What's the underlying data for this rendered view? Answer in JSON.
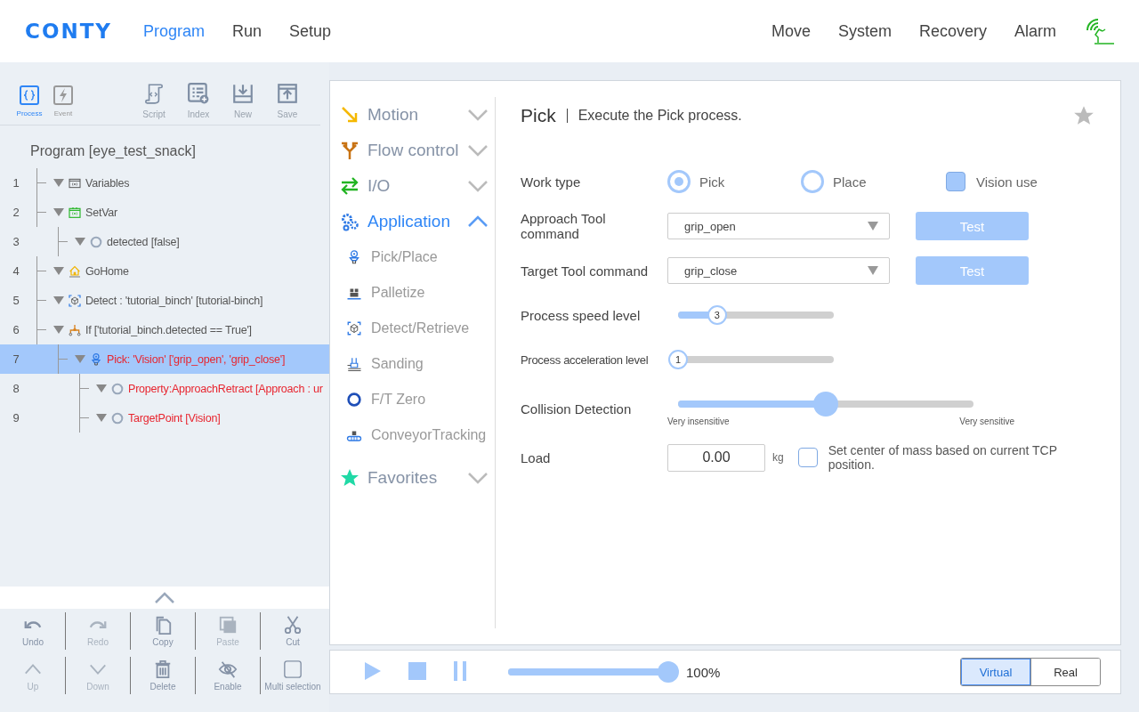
{
  "header": {
    "logo": "CONTY",
    "nav": [
      {
        "label": "Program",
        "selected": true
      },
      {
        "label": "Run",
        "selected": false
      },
      {
        "label": "Setup",
        "selected": false
      }
    ],
    "right_nav": [
      "Move",
      "System",
      "Recovery",
      "Alarm"
    ]
  },
  "left_panel": {
    "modes": [
      {
        "label": "Process",
        "kind": "process",
        "selected": true
      },
      {
        "label": "Event",
        "kind": "event",
        "selected": false
      }
    ],
    "tools": [
      {
        "label": "Script",
        "kind": "script"
      },
      {
        "label": "Index",
        "kind": "index"
      },
      {
        "label": "New",
        "kind": "new"
      },
      {
        "label": "Save",
        "kind": "save"
      }
    ],
    "program_title": "Program [eye_test_snack]",
    "tree": [
      {
        "line": "1",
        "label": "Variables",
        "kind": "variables",
        "selected": false,
        "color": "#555555"
      },
      {
        "line": "2",
        "label": "SetVar",
        "kind": "setvar",
        "selected": false,
        "color": "#555555",
        "children": [
          {
            "line": "3",
            "label": "detected [false]",
            "kind": "property",
            "selected": false,
            "color": "#555555"
          }
        ]
      },
      {
        "line": "4",
        "label": "GoHome",
        "kind": "home",
        "selected": false,
        "color": "#555555"
      },
      {
        "line": "5",
        "label": "Detect : 'tutorial_binch' [tutorial-binch]",
        "kind": "detect",
        "selected": false,
        "color": "#555555"
      },
      {
        "line": "6",
        "label": "If ['tutorial_binch.detected == True']",
        "kind": "if",
        "selected": false,
        "color": "#555555",
        "children": [
          {
            "line": "7",
            "label": "Pick: 'Vision' ['grip_open', 'grip_close']",
            "kind": "pick",
            "selected": true,
            "color": "#e8252f",
            "children": [
              {
                "line": "8",
                "label": "Property:ApproachRetract [Approach : ur",
                "kind": "property",
                "selected": false,
                "color": "#e8252f"
              },
              {
                "line": "9",
                "label": "TargetPoint [Vision]",
                "kind": "property",
                "selected": false,
                "color": "#e8252f"
              }
            ]
          }
        ]
      }
    ],
    "edit_tools": [
      {
        "label": "Undo",
        "kind": "undo",
        "disabled": false
      },
      {
        "label": "Redo",
        "kind": "redo",
        "disabled": true
      },
      {
        "label": "Copy",
        "kind": "copy",
        "disabled": false
      },
      {
        "label": "Paste",
        "kind": "paste",
        "disabled": true
      },
      {
        "label": "Cut",
        "kind": "cut",
        "disabled": false
      },
      {
        "label": "Up",
        "kind": "up",
        "disabled": true
      },
      {
        "label": "Down",
        "kind": "down",
        "disabled": true
      },
      {
        "label": "Delete",
        "kind": "delete",
        "disabled": false
      },
      {
        "label": "Enable",
        "kind": "enable",
        "disabled": false
      },
      {
        "label": "Multi selection",
        "kind": "multi",
        "disabled": false
      }
    ]
  },
  "command_menu": [
    {
      "label": "Motion",
      "kind": "motion",
      "expanded": false
    },
    {
      "label": "Flow control",
      "kind": "flow",
      "expanded": false
    },
    {
      "label": "I/O",
      "kind": "io",
      "expanded": false
    },
    {
      "label": "Application",
      "kind": "application",
      "expanded": true,
      "children": [
        {
          "label": "Pick/Place",
          "kind": "pick"
        },
        {
          "label": "Palletize",
          "kind": "palletize"
        },
        {
          "label": "Detect/Retrieve",
          "kind": "detect"
        },
        {
          "label": "Sanding",
          "kind": "sanding"
        },
        {
          "label": "F/T Zero",
          "kind": "ftzero"
        },
        {
          "label": "ConveyorTracking",
          "kind": "conveyor"
        }
      ]
    },
    {
      "label": "Favorites",
      "kind": "favorites",
      "expanded": false
    }
  ],
  "command": {
    "title": "Pick",
    "description": "Execute the Pick process.",
    "favorite": false,
    "work_type": {
      "label": "Work type",
      "options": [
        {
          "label": "Pick",
          "selected": true
        },
        {
          "label": "Place",
          "selected": false
        }
      ],
      "vision_use": {
        "label": "Vision use",
        "checked": true
      }
    },
    "tool_commands": [
      {
        "label": "Approach Tool command",
        "value": "grip_open",
        "button": "Test"
      },
      {
        "label": "Target Tool command",
        "value": "grip_close",
        "button": "Test"
      }
    ],
    "levels": [
      {
        "label": "Process speed level",
        "level": 0.25,
        "value": "3",
        "kind": "small"
      },
      {
        "label": "Process acceleration level",
        "level": 0,
        "value": "1",
        "kind": "tiny"
      }
    ],
    "collision": {
      "label": "Collision Detection",
      "level": 0.5,
      "min_label": "Very insensitive",
      "max_label": "Very sensitive"
    },
    "load": {
      "label": "Load",
      "value": "0.00",
      "unit": "kg",
      "center_of_mass": {
        "label": "Set center of mass based on current TCP position.",
        "checked": false
      }
    }
  },
  "playback": {
    "speed": {
      "level": 1,
      "reading": "100%"
    },
    "modes": [
      {
        "label": "Virtual",
        "selected": true
      },
      {
        "label": "Real",
        "selected": false
      }
    ]
  }
}
